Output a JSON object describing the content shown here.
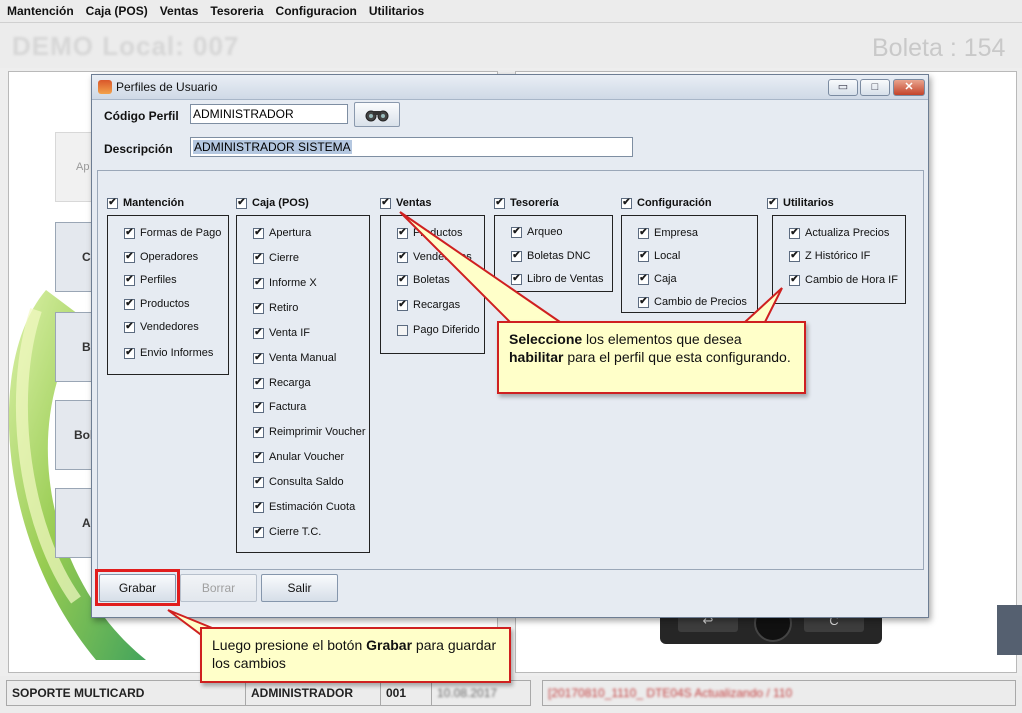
{
  "menubar": {
    "items": [
      "Mantención",
      "Caja (POS)",
      "Ventas",
      "Tesoreria",
      "Configuracion",
      "Utilitarios"
    ]
  },
  "app": {
    "local_title": "DEMO Local: 007",
    "boleta_title": "Boleta : 154",
    "side_buttons": [
      "Ap",
      "C",
      "Bo",
      "Bol",
      "Ac"
    ]
  },
  "device": {
    "left_key": "↩",
    "right_key": "C"
  },
  "status": {
    "company": "SOPORTE MULTICARD",
    "user": "ADMINISTRADOR",
    "terminal": "001",
    "date": "10.08.2017",
    "message": "[20170810_1110_ DTE04S Actualizando / 110"
  },
  "dialog": {
    "title": "Perfiles de Usuario",
    "codigo_label": "Código Perfil",
    "codigo_value": "ADMINISTRADOR",
    "descripcion_label": "Descripción",
    "descripcion_value": "ADMINISTRADOR SISTEMA",
    "buttons": {
      "grabar": "Grabar",
      "borrar": "Borrar",
      "salir": "Salir"
    },
    "groups": [
      {
        "title": "Mantención",
        "checked": true,
        "items": [
          {
            "label": "Formas de Pago",
            "checked": true
          },
          {
            "label": "Operadores",
            "checked": true
          },
          {
            "label": "Perfiles",
            "checked": true
          },
          {
            "label": "Productos",
            "checked": true
          },
          {
            "label": "Vendedores",
            "checked": true
          },
          {
            "label": "Envio Informes",
            "checked": true
          }
        ]
      },
      {
        "title": "Caja (POS)",
        "checked": true,
        "items": [
          {
            "label": "Apertura",
            "checked": true
          },
          {
            "label": "Cierre",
            "checked": true
          },
          {
            "label": "Informe X",
            "checked": true
          },
          {
            "label": "Retiro",
            "checked": true
          },
          {
            "label": "Venta IF",
            "checked": true
          },
          {
            "label": "Venta Manual",
            "checked": true
          },
          {
            "label": "Recarga",
            "checked": true
          },
          {
            "label": "Factura",
            "checked": true
          },
          {
            "label": "Reimprimir Voucher",
            "checked": true
          },
          {
            "label": "Anular Voucher",
            "checked": true
          },
          {
            "label": "Consulta Saldo",
            "checked": true
          },
          {
            "label": "Estimación Cuota",
            "checked": true
          },
          {
            "label": "Cierre T.C.",
            "checked": true
          }
        ]
      },
      {
        "title": "Ventas",
        "checked": true,
        "items": [
          {
            "label": "Productos",
            "checked": true
          },
          {
            "label": "Vendedores",
            "checked": true
          },
          {
            "label": "Boletas",
            "checked": true
          },
          {
            "label": "Recargas",
            "checked": true
          },
          {
            "label": "Pago Diferido",
            "checked": false
          }
        ]
      },
      {
        "title": "Tesorería",
        "checked": true,
        "items": [
          {
            "label": "Arqueo",
            "checked": true
          },
          {
            "label": "Boletas DNC",
            "checked": true
          },
          {
            "label": "Libro de Ventas",
            "checked": true
          }
        ]
      },
      {
        "title": "Configuración",
        "checked": true,
        "items": [
          {
            "label": "Empresa",
            "checked": true
          },
          {
            "label": "Local",
            "checked": true
          },
          {
            "label": "Caja",
            "checked": true
          },
          {
            "label": "Cambio de Precios",
            "checked": true
          }
        ]
      },
      {
        "title": "Utilitarios",
        "checked": true,
        "items": [
          {
            "label": "Actualiza Precios",
            "checked": true
          },
          {
            "label": "Z Histórico IF",
            "checked": true
          },
          {
            "label": "Cambio de Hora IF",
            "checked": true
          }
        ]
      }
    ]
  },
  "callouts": {
    "select": {
      "bold1": "Seleccione",
      "text1": " los elementos que desea ",
      "bold2": "habilitar",
      "text2": " para el perfil que esta configurando."
    },
    "save": {
      "text1": "Luego presione el botón ",
      "bold": "Grabar",
      "text2": " para guardar los cambios"
    }
  },
  "colors": {
    "callout_bg": "#ffffc9",
    "highlight_red": "#e11d1d",
    "dialog_bg": "#e6ebf2"
  }
}
